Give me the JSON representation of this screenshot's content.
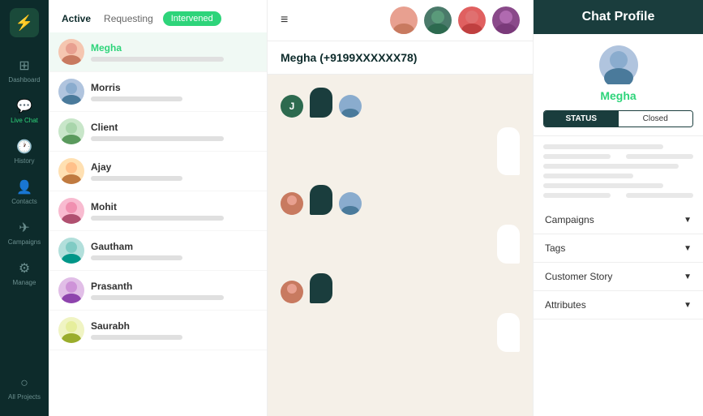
{
  "sidebar": {
    "logo": "⚡",
    "items": [
      {
        "id": "dashboard",
        "icon": "⊞",
        "label": "Dashboard",
        "active": false
      },
      {
        "id": "live-chat",
        "icon": "💬",
        "label": "Live Chat",
        "active": true
      },
      {
        "id": "history",
        "icon": "🕐",
        "label": "History",
        "active": false
      },
      {
        "id": "contacts",
        "icon": "👤",
        "label": "Contacts",
        "active": false
      },
      {
        "id": "campaigns",
        "icon": "✈",
        "label": "Campaigns",
        "active": false
      },
      {
        "id": "manage",
        "icon": "⚙",
        "label": "Manage",
        "active": false
      },
      {
        "id": "all-projects",
        "icon": "○",
        "label": "All Projects",
        "active": false
      }
    ]
  },
  "tabs": {
    "active_label": "Active",
    "requesting_label": "Requesting",
    "intervened_label": "Intervened"
  },
  "chat_list": [
    {
      "name": "Megha",
      "selected": true,
      "highlight": true
    },
    {
      "name": "Morris",
      "selected": false,
      "highlight": false
    },
    {
      "name": "Client",
      "selected": false,
      "highlight": false
    },
    {
      "name": "Ajay",
      "selected": false,
      "highlight": false
    },
    {
      "name": "Mohit",
      "selected": false,
      "highlight": false
    },
    {
      "name": "Gautham",
      "selected": false,
      "highlight": false
    },
    {
      "name": "Prasanth",
      "selected": false,
      "highlight": false
    },
    {
      "name": "Saurabh",
      "selected": false,
      "highlight": false
    }
  ],
  "chat_header": {
    "title": "Megha (+9199XXXXXX78)"
  },
  "right_panel": {
    "title": "Chat Profile",
    "profile_name": "Megha",
    "status_label": "STATUS",
    "status_value": "Closed",
    "accordion_items": [
      {
        "label": "Campaigns"
      },
      {
        "label": "Tags"
      },
      {
        "label": "Customer Story"
      },
      {
        "label": "Attributes"
      }
    ]
  }
}
